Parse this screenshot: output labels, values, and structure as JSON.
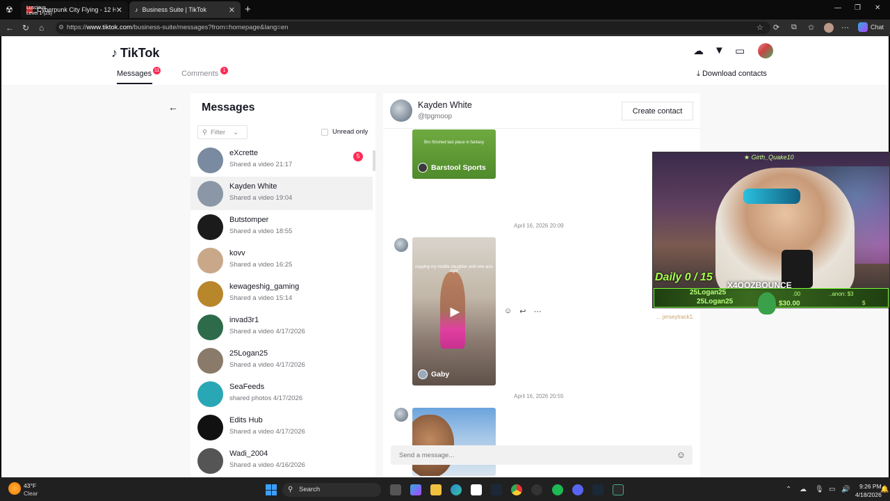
{
  "browser": {
    "tabs": [
      {
        "label": "Cyberpunk City Flying - 12 H",
        "overlay_text": "Luscious",
        "overlay_sub": "Level 1  (25)"
      },
      {
        "label": "Business Suite | TikTok"
      }
    ],
    "url_prefix": "https://",
    "url_host": "www.tiktok.com",
    "url_path": "/business-suite/messages?from=homepage&lang=en",
    "chat_label": "Chat"
  },
  "header": {
    "logo_text": "TikTok",
    "tabs": [
      {
        "label": "Messages",
        "badge": "11"
      },
      {
        "label": "Comments",
        "badge": "1"
      }
    ],
    "download_label": "Download contacts"
  },
  "list": {
    "title": "Messages",
    "filter_label": "Filter",
    "unread_label": "Unread only",
    "items": [
      {
        "name": "eXcrette",
        "sub": "Shared a video 21:17",
        "count": "5",
        "color": "#7a8aa0"
      },
      {
        "name": "Kayden White",
        "sub": "Shared a video 19:04",
        "color": "#8b97a6"
      },
      {
        "name": "Butstomper",
        "sub": "Shared a video 18:55",
        "color": "#1b1b1b"
      },
      {
        "name": "kovv",
        "sub": "Shared a video 16:25",
        "color": "#c9a88a"
      },
      {
        "name": "kewageshig_gaming",
        "sub": "Shared a video 15:14",
        "color": "#b8862b"
      },
      {
        "name": "invad3r1",
        "sub": "Shared a video 4/17/2026",
        "color": "#2e6b4a"
      },
      {
        "name": "25Logan25",
        "sub": "Shared a video 4/17/2026",
        "color": "#8a7a6a"
      },
      {
        "name": "SeaFeeds",
        "sub": "shared photos 4/17/2026",
        "color": "#2aa7b5"
      },
      {
        "name": "Edits Hub",
        "sub": "Shared a video 4/17/2026",
        "color": "#111111"
      },
      {
        "name": "Wadi_2004",
        "sub": "Shared a video 4/16/2026",
        "color": "#555555"
      }
    ]
  },
  "conversation": {
    "name": "Kayden White",
    "handle": "@tpgmoop",
    "create_contact_label": "Create contact",
    "messages": [
      {
        "credit": "Barstool Sports",
        "caption": "Bro finished last place in fantasy"
      },
      {
        "timestamp": "April 16, 2026 20:09",
        "credit": "Gaby",
        "caption": "copying my middle daughter until she acts right"
      },
      {
        "timestamp": "April 16, 2026 20:55"
      }
    ],
    "composer_placeholder": "Send a message..."
  },
  "stream_overlay": {
    "top_user": "Girth_Quake10",
    "brand": "X4OOZBOUNCE",
    "daily": "Daily 0 / 15",
    "line1": "25Logan25",
    "line2": "25Logan25",
    "amount1": ".00",
    "amount2": "$30.00",
    "anon": "..anon: $3",
    "dollar": "$",
    "chat_prefix": "...",
    "chat_user": "jerseytrack1:"
  },
  "taskbar": {
    "weather_temp": "43°F",
    "weather_desc": "Clear",
    "search_label": "Search",
    "time": "9:26 PM",
    "date": "4/18/2026"
  },
  "colors": {
    "accent": "#fe2c55",
    "text": "#161823",
    "muted": "#73747a"
  }
}
